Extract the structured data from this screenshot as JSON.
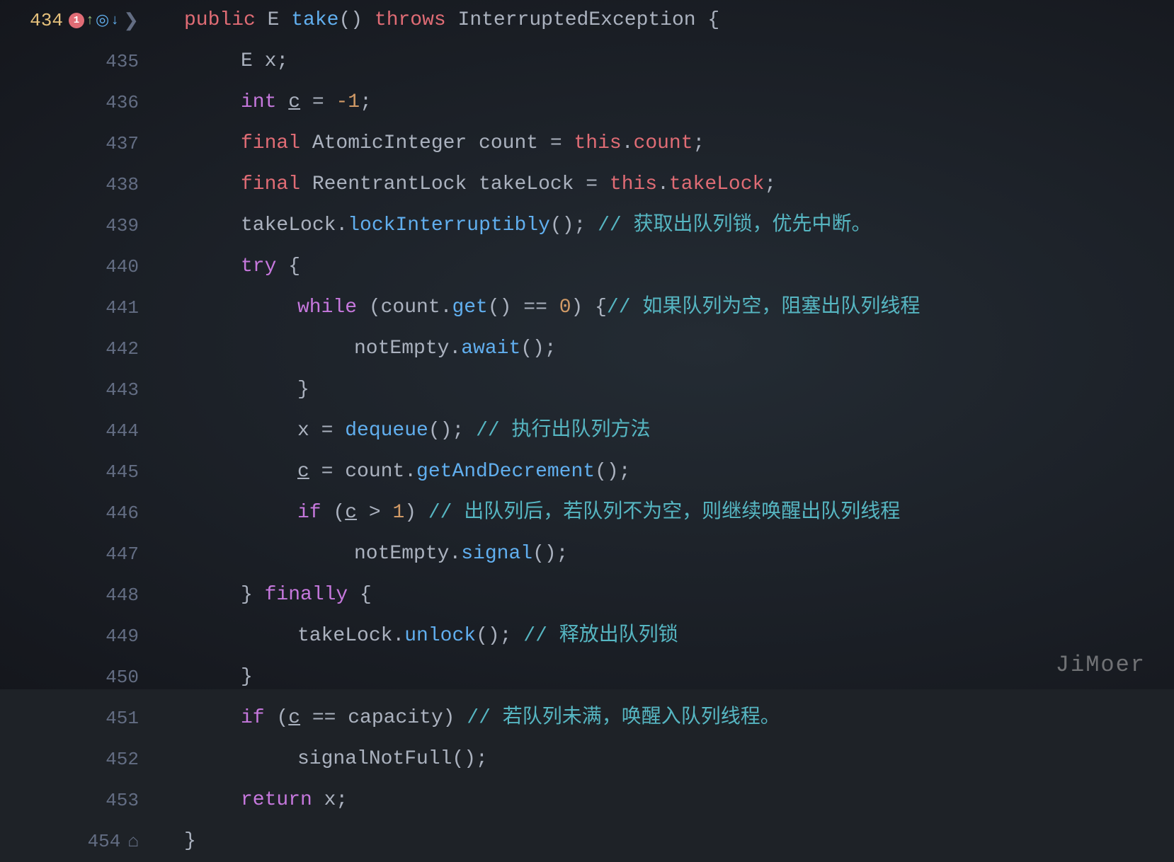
{
  "editor": {
    "lines": [
      {
        "number": "434",
        "active": true,
        "hasErrorIcon": true,
        "hasArrowUp": true,
        "hasBookmark": true,
        "hasArrowDown": true,
        "indent": 0,
        "tokens": [
          {
            "t": "kw",
            "v": "public"
          },
          {
            "t": "plain",
            "v": " E "
          },
          {
            "t": "method",
            "v": "take"
          },
          {
            "t": "plain",
            "v": "() "
          },
          {
            "t": "kw",
            "v": "throws"
          },
          {
            "t": "plain",
            "v": " InterruptedException {"
          }
        ]
      },
      {
        "number": "435",
        "indent": 1,
        "tokens": [
          {
            "t": "plain",
            "v": "E x;"
          }
        ]
      },
      {
        "number": "436",
        "indent": 1,
        "tokens": [
          {
            "t": "kw2",
            "v": "int"
          },
          {
            "t": "plain",
            "v": " "
          },
          {
            "t": "underline plain",
            "v": "c"
          },
          {
            "t": "plain",
            "v": " = "
          },
          {
            "t": "num",
            "v": "-1"
          },
          {
            "t": "plain",
            "v": ";"
          }
        ]
      },
      {
        "number": "437",
        "indent": 1,
        "tokens": [
          {
            "t": "kw",
            "v": "final"
          },
          {
            "t": "plain",
            "v": " AtomicInteger count = "
          },
          {
            "t": "this-kw",
            "v": "this"
          },
          {
            "t": "plain",
            "v": "."
          },
          {
            "t": "field",
            "v": "count"
          },
          {
            "t": "plain",
            "v": ";"
          }
        ]
      },
      {
        "number": "438",
        "indent": 1,
        "tokens": [
          {
            "t": "kw",
            "v": "final"
          },
          {
            "t": "plain",
            "v": " ReentrantLock takeLock = "
          },
          {
            "t": "this-kw",
            "v": "this"
          },
          {
            "t": "plain",
            "v": "."
          },
          {
            "t": "field",
            "v": "takeLock"
          },
          {
            "t": "plain",
            "v": ";"
          }
        ]
      },
      {
        "number": "439",
        "indent": 1,
        "tokens": [
          {
            "t": "plain",
            "v": "takeLock."
          },
          {
            "t": "method",
            "v": "lockInterruptibly"
          },
          {
            "t": "plain",
            "v": "(); "
          },
          {
            "t": "comment-zh",
            "v": "// 获取出队列锁，优先中断。"
          }
        ]
      },
      {
        "number": "440",
        "indent": 1,
        "tokens": [
          {
            "t": "kw2",
            "v": "try"
          },
          {
            "t": "plain",
            "v": " {"
          }
        ]
      },
      {
        "number": "441",
        "indent": 2,
        "tokens": [
          {
            "t": "kw2",
            "v": "while"
          },
          {
            "t": "plain",
            "v": " (count."
          },
          {
            "t": "method",
            "v": "get"
          },
          {
            "t": "plain",
            "v": "() == "
          },
          {
            "t": "num",
            "v": "0"
          },
          {
            "t": "plain",
            "v": ") {"
          },
          {
            "t": "comment-zh",
            "v": "// 如果队列为空，阻塞出队列线程"
          }
        ]
      },
      {
        "number": "442",
        "indent": 3,
        "tokens": [
          {
            "t": "plain",
            "v": "notEmpty."
          },
          {
            "t": "method",
            "v": "await"
          },
          {
            "t": "plain",
            "v": "();"
          }
        ]
      },
      {
        "number": "443",
        "indent": 2,
        "tokens": [
          {
            "t": "plain",
            "v": "}"
          }
        ]
      },
      {
        "number": "444",
        "indent": 2,
        "tokens": [
          {
            "t": "plain",
            "v": "x = "
          },
          {
            "t": "method",
            "v": "dequeue"
          },
          {
            "t": "plain",
            "v": "(); "
          },
          {
            "t": "comment-zh",
            "v": "// 执行出队列方法"
          }
        ]
      },
      {
        "number": "445",
        "indent": 2,
        "tokens": [
          {
            "t": "underline plain",
            "v": "c"
          },
          {
            "t": "plain",
            "v": " = count."
          },
          {
            "t": "method",
            "v": "getAndDecrement"
          },
          {
            "t": "plain",
            "v": "();"
          }
        ]
      },
      {
        "number": "446",
        "indent": 2,
        "tokens": [
          {
            "t": "kw2",
            "v": "if"
          },
          {
            "t": "plain",
            "v": " ("
          },
          {
            "t": "underline plain",
            "v": "c"
          },
          {
            "t": "plain",
            "v": " > "
          },
          {
            "t": "num",
            "v": "1"
          },
          {
            "t": "plain",
            "v": ") "
          },
          {
            "t": "comment-zh",
            "v": "// 出队列后，若队列不为空，则继续唤醒出队列线程"
          }
        ]
      },
      {
        "number": "447",
        "indent": 3,
        "tokens": [
          {
            "t": "plain",
            "v": "notEmpty."
          },
          {
            "t": "method",
            "v": "signal"
          },
          {
            "t": "plain",
            "v": "();"
          }
        ]
      },
      {
        "number": "448",
        "indent": 1,
        "tokens": [
          {
            "t": "plain",
            "v": "} "
          },
          {
            "t": "kw2",
            "v": "finally"
          },
          {
            "t": "plain",
            "v": " {"
          }
        ]
      },
      {
        "number": "449",
        "indent": 2,
        "tokens": [
          {
            "t": "plain",
            "v": "takeLock."
          },
          {
            "t": "method",
            "v": "unlock"
          },
          {
            "t": "plain",
            "v": "(); "
          },
          {
            "t": "comment-zh",
            "v": "// 释放出队列锁"
          }
        ]
      },
      {
        "number": "450",
        "indent": 1,
        "tokens": [
          {
            "t": "plain",
            "v": "}"
          }
        ]
      },
      {
        "number": "451",
        "indent": 1,
        "tokens": [
          {
            "t": "kw2",
            "v": "if"
          },
          {
            "t": "plain",
            "v": " ("
          },
          {
            "t": "underline plain",
            "v": "c"
          },
          {
            "t": "plain",
            "v": " == capacity) "
          },
          {
            "t": "comment-zh",
            "v": "// 若队列未满，唤醒入队列线程。"
          }
        ]
      },
      {
        "number": "452",
        "indent": 2,
        "tokens": [
          {
            "t": "plain",
            "v": "signalNotFull();"
          }
        ]
      },
      {
        "number": "453",
        "indent": 1,
        "tokens": [
          {
            "t": "kw2",
            "v": "return"
          },
          {
            "t": "plain",
            "v": " x;"
          }
        ]
      },
      {
        "number": "454",
        "indent": 0,
        "hasBottomMarker": true,
        "tokens": [
          {
            "t": "plain",
            "v": "}"
          }
        ]
      }
    ],
    "watermark": "JiMoer"
  }
}
